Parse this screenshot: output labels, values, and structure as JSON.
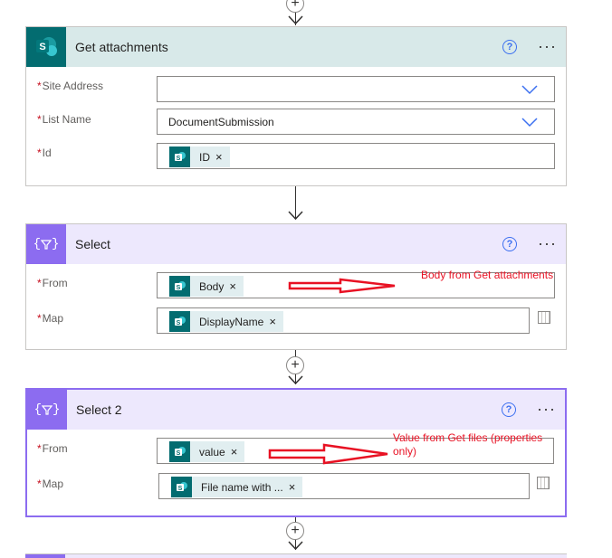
{
  "get_attachments": {
    "title": "Get attachments",
    "help": "?",
    "more": "···",
    "fields": {
      "site_address": {
        "label": "Site Address",
        "required": "*",
        "value": ""
      },
      "list_name": {
        "label": "List Name",
        "required": "*",
        "value": "DocumentSubmission"
      },
      "id": {
        "label": "Id",
        "required": "*",
        "token": "ID",
        "remove": "×"
      }
    }
  },
  "select": {
    "title": "Select",
    "help": "?",
    "more": "···",
    "fields": {
      "from": {
        "label": "From",
        "required": "*",
        "token": "Body",
        "remove": "×"
      },
      "map": {
        "label": "Map",
        "required": "*",
        "token": "DisplayName",
        "remove": "×"
      }
    }
  },
  "select_2": {
    "title": "Select 2",
    "help": "?",
    "more": "···",
    "fields": {
      "from": {
        "label": "From",
        "required": "*",
        "token": "value",
        "remove": "×"
      },
      "map": {
        "label": "Map",
        "required": "*",
        "token": "File name with ...",
        "remove": "×"
      }
    }
  },
  "annotations": {
    "body_note": "Body from Get attachments",
    "value_note_line1": "Value from Get files (properties",
    "value_note_line2": "only)"
  },
  "add_step": "+",
  "colors": {
    "sharepoint_header": "#d8e9e9",
    "sharepoint_icon": "#036c70",
    "select_header": "#ede8fd",
    "select_icon": "#8c6cf0",
    "annotation_red": "#e81123"
  }
}
